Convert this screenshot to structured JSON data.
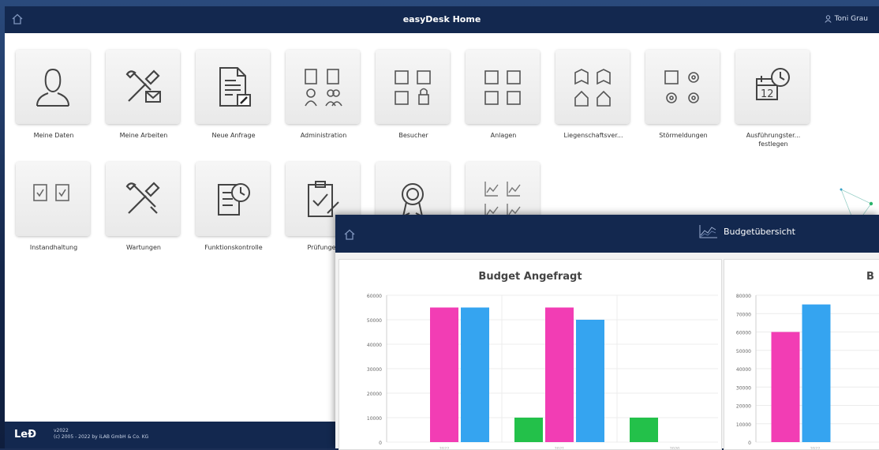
{
  "app": {
    "title": "easyDesk Home",
    "user": "Toni Grau"
  },
  "tiles": [
    {
      "label": "Meine Daten",
      "icon": "user-icon"
    },
    {
      "label": "Meine Arbeiten",
      "icon": "tools-icon"
    },
    {
      "label": "Neue Anfrage",
      "icon": "new-request-icon"
    },
    {
      "label": "Administration",
      "icon": "administration-icon"
    },
    {
      "label": "Besucher",
      "icon": "visitor-icon"
    },
    {
      "label": "Anlagen",
      "icon": "assets-icon"
    },
    {
      "label": "Liegenschaftsver...",
      "icon": "property-icon"
    },
    {
      "label": "Störmeldungen",
      "icon": "fault-reports-icon"
    },
    {
      "label": "Ausführungster... festlegen",
      "icon": "calendar-clock-icon"
    },
    {
      "label": "Instandhaltung",
      "icon": "clipboard-check-icon"
    },
    {
      "label": "Wartungen",
      "icon": "tools-icon"
    },
    {
      "label": "Funktionskontrolle",
      "icon": "checklist-clock-icon"
    },
    {
      "label": "Prüfungen",
      "icon": "clipboard-pen-icon"
    },
    {
      "label": "",
      "icon": "certificate-icon"
    },
    {
      "label": "",
      "icon": "line-charts-icon"
    }
  ],
  "footer": {
    "logo": "LeÐ",
    "version": "v2022",
    "copyright": "(c) 2005 - 2022 by iLAB GmbH & Co. KG"
  },
  "budget_window": {
    "title": "Budgetübersicht"
  },
  "colors": {
    "navy": "#13284f",
    "pink": "#f23db4",
    "blue": "#35a4f0",
    "green": "#23c14a"
  },
  "chart_data": [
    {
      "type": "bar",
      "title": "Budget Angefragt",
      "categories": [
        "2022",
        "2021",
        "2020"
      ],
      "series": [
        {
          "values": [
            0,
            10000,
            10000
          ],
          "color": "#23c14a"
        },
        {
          "values": [
            55000,
            55000,
            0
          ],
          "color": "#f23db4"
        },
        {
          "values": [
            55000,
            50000,
            0
          ],
          "color": "#35a4f0"
        }
      ],
      "ylim": [
        0,
        60000
      ],
      "yticks": [
        0,
        10000,
        20000,
        30000,
        40000,
        50000,
        60000
      ],
      "grid": true
    },
    {
      "type": "bar",
      "title": "B",
      "categories": [
        "2022"
      ],
      "series": [
        {
          "values": [
            60000
          ],
          "color": "#f23db4"
        },
        {
          "values": [
            75000
          ],
          "color": "#35a4f0"
        }
      ],
      "ylim": [
        0,
        80000
      ],
      "yticks": [
        0,
        10000,
        20000,
        30000,
        40000,
        50000,
        60000,
        70000,
        80000
      ],
      "grid": true
    }
  ]
}
